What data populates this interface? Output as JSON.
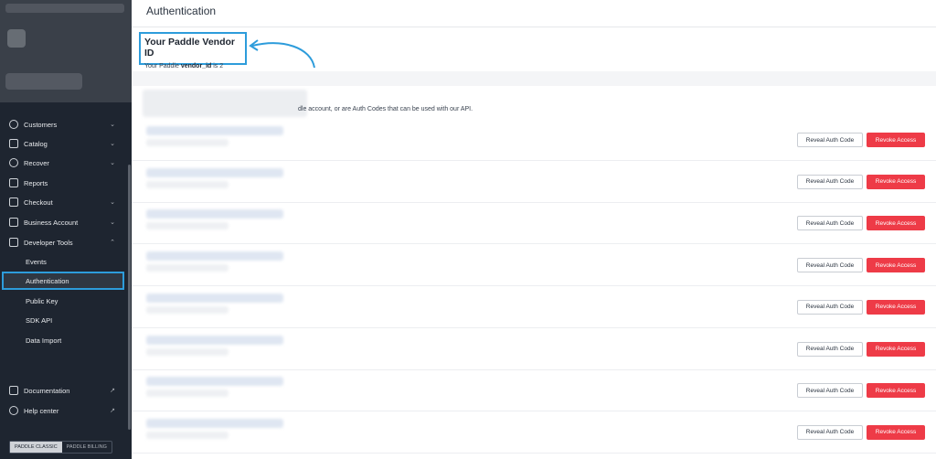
{
  "sidebar": {
    "items": [
      {
        "label": "Customers",
        "icon": "user-circle-icon"
      },
      {
        "label": "Catalog",
        "icon": "catalog-icon"
      },
      {
        "label": "Recover",
        "icon": "recover-icon"
      },
      {
        "label": "Reports",
        "icon": "reports-icon"
      },
      {
        "label": "Checkout",
        "icon": "card-icon"
      },
      {
        "label": "Business Account",
        "icon": "building-icon"
      },
      {
        "label": "Developer Tools",
        "icon": "sliders-icon"
      }
    ],
    "sub_items": [
      "Events",
      "Authentication",
      "Public Key",
      "SDK API",
      "Data Import"
    ],
    "footer": [
      {
        "label": "Documentation",
        "icon": "book-icon"
      },
      {
        "label": "Help center",
        "icon": "help-icon"
      }
    ],
    "toggle": {
      "classic": "PADDLE CLASSIC",
      "billing": "PADDLE BILLING"
    }
  },
  "main": {
    "title": "Authentication",
    "vendor": {
      "heading": "Your Paddle Vendor ID",
      "prefix": "Your Paddle",
      "key": "vendor_id",
      "mid": "is",
      "value": "2"
    },
    "description": "dle account, or are Auth Codes that can be used with our API.",
    "buttons": {
      "reveal": "Reveal Auth Code",
      "revoke": "Revoke Access"
    },
    "row_count": 8
  },
  "colors": {
    "accent": "#2d9cdb",
    "danger": "#ee3b47",
    "sidebar": "#1e2530"
  }
}
